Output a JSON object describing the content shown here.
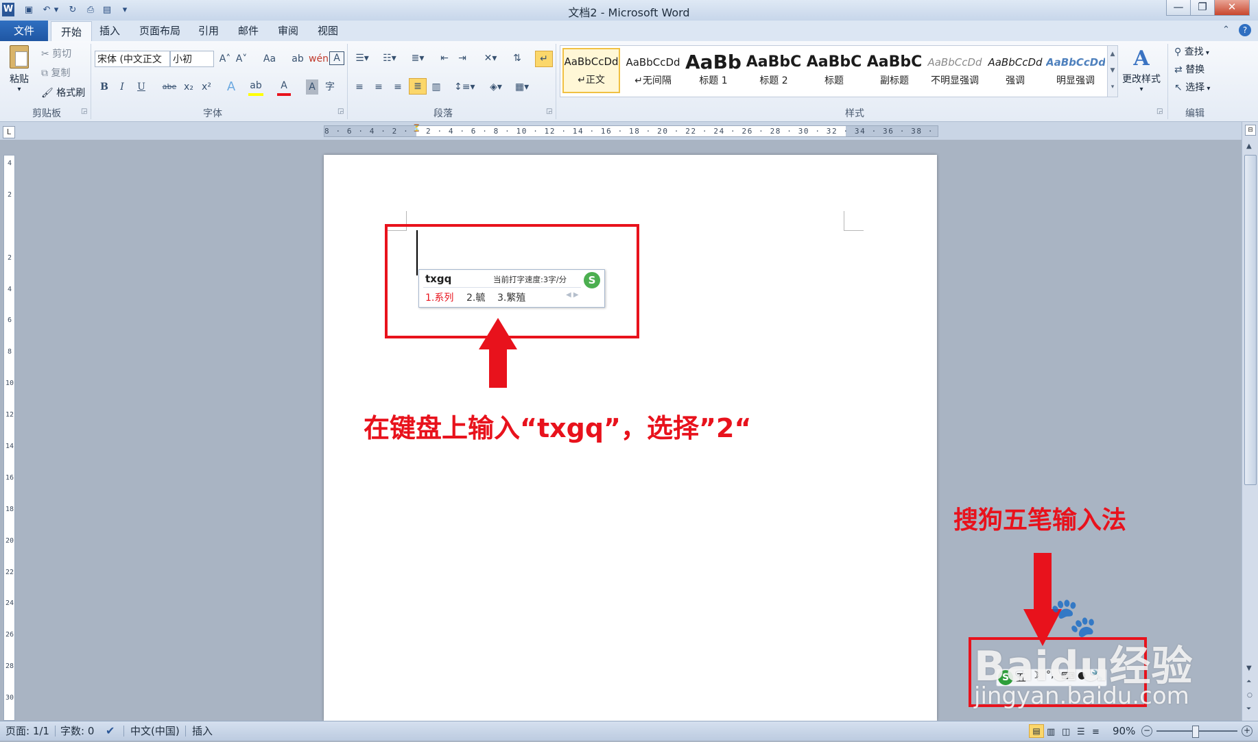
{
  "window": {
    "title": "文档2 - Microsoft Word",
    "app_icon": "W",
    "quick_access": [
      "save-icon",
      "undo-icon",
      "undo-dropdown-icon",
      "redo-icon",
      "print-icon",
      "print-preview-icon",
      "customize-dropdown-icon"
    ],
    "controls": {
      "minimize": "—",
      "restore": "❐",
      "close": "✕"
    }
  },
  "tabs": [
    "文件",
    "开始",
    "插入",
    "页面布局",
    "引用",
    "邮件",
    "审阅",
    "视图"
  ],
  "ribbon": {
    "clipboard": {
      "paste": "粘贴",
      "cut": "剪切",
      "copy": "复制",
      "format_painter": "格式刷",
      "label": "剪贴板"
    },
    "font": {
      "font_name": "宋体 (中文正文",
      "font_size": "小初",
      "label": "字体",
      "row1": [
        "A˄",
        "A˅",
        "Aa",
        "ab",
        "wén",
        "A"
      ],
      "row2": [
        "B",
        "I",
        "U",
        "abe",
        "x₂",
        "x²",
        "A",
        "ab",
        "A",
        "A",
        "字"
      ]
    },
    "paragraph": {
      "label": "段落"
    },
    "styles": {
      "label": "样式",
      "items": [
        {
          "sample": "AaBbCcDd",
          "name": "↵正文"
        },
        {
          "sample": "AaBbCcDd",
          "name": "↵无间隔"
        },
        {
          "sample": "AaBb",
          "name": "标题 1"
        },
        {
          "sample": "AaBbC",
          "name": "标题 2"
        },
        {
          "sample": "AaBbC",
          "name": "标题"
        },
        {
          "sample": "AaBbC",
          "name": "副标题"
        },
        {
          "sample": "AaBbCcDd",
          "name": "不明显强调"
        },
        {
          "sample": "AaBbCcDd",
          "name": "强调"
        },
        {
          "sample": "AaBbCcDd",
          "name": "明显强调"
        }
      ],
      "change_styles": "更改样式"
    },
    "editing": {
      "find": "查找",
      "replace": "替换",
      "select": "选择",
      "label": "编辑"
    }
  },
  "ruler": {
    "horizontal": "8 · 6 · 4 · 2 ·   · 2 · 4 · 6 · 8 · 10 · 12 · 14 · 16 · 18 · 20 · 22 · 24 · 26 · 28 · 30 · 32 · 34 · 36 · 38 · 40 · 42 · 44 · 46 · 48",
    "vertical": [
      "4",
      "2",
      "",
      "2",
      "4",
      "6",
      "8",
      "10",
      "12",
      "14",
      "16",
      "18",
      "20",
      "22",
      "24",
      "26",
      "28",
      "30"
    ]
  },
  "ime_popup": {
    "input": "txgq",
    "speed": "当前打字速度:3字/分",
    "candidates": [
      "1.系列",
      "2.毓",
      "3.繁殖"
    ]
  },
  "annotations": {
    "main_text": "在键盘上输入“txgq”，选择”2“",
    "ime_name": "搜狗五笔输入法"
  },
  "ime_toolbar": {
    "mode": "五",
    "icons": [
      "sogou-logo-icon",
      "moon-icon",
      "punctuation-icon",
      "keyboard-icon",
      "user-icon",
      "wrench-icon"
    ]
  },
  "watermark": {
    "brand": "Baidu经验",
    "url": "jingyan.baidu.com"
  },
  "statusbar": {
    "page": "页面: 1/1",
    "words": "字数: 0",
    "language": "中文(中国)",
    "mode": "插入",
    "zoom": "90%"
  },
  "colors": {
    "accent_red": "#e8121c",
    "file_tab": "#2f6fc1",
    "ribbon_bg": "#e4ebf5"
  }
}
